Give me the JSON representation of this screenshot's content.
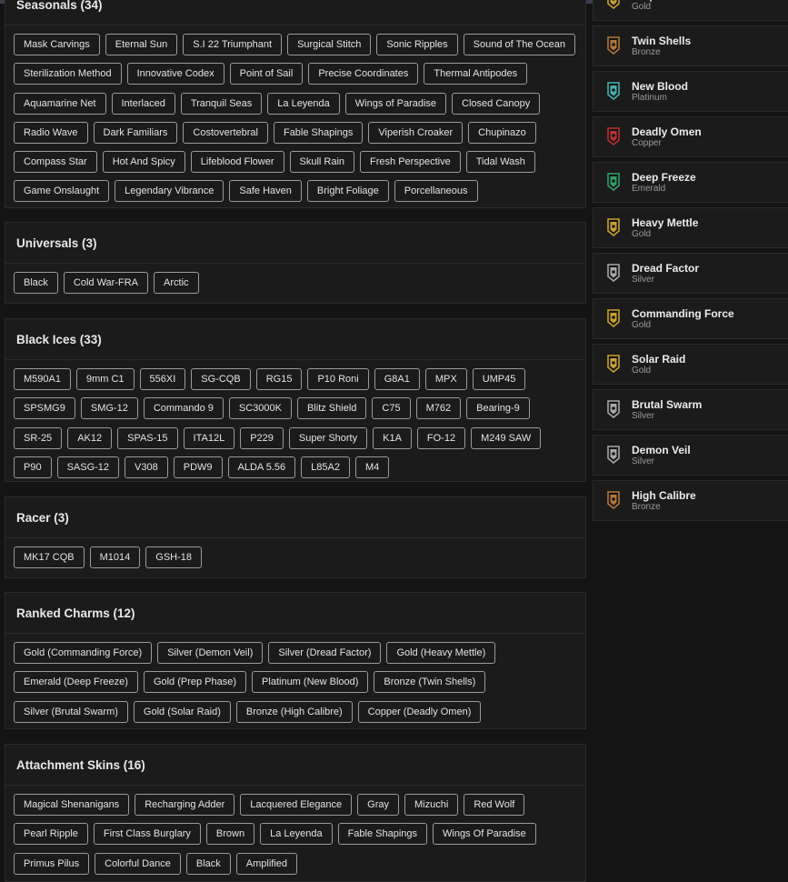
{
  "sections": [
    {
      "title": "Seasonals (34)",
      "items": [
        "Mask Carvings",
        "Eternal Sun",
        "S.I 22 Triumphant",
        "Surgical Stitch",
        "Sonic Ripples",
        "Sound of The Ocean",
        "Sterilization Method",
        "Innovative Codex",
        "Point of Sail",
        "Precise Coordinates",
        "Thermal Antipodes",
        "Aquamarine Net",
        "Interlaced",
        "Tranquil Seas",
        "La Leyenda",
        "Wings of Paradise",
        "Closed Canopy",
        "Radio Wave",
        "Dark Familiars",
        "Costovertebral",
        "Fable Shapings",
        "Viperish Croaker",
        "Chupinazo",
        "Compass Star",
        "Hot And Spicy",
        "Lifeblood Flower",
        "Skull Rain",
        "Fresh Perspective",
        "Tidal Wash",
        "Game Onslaught",
        "Legendary Vibrance",
        "Safe Haven",
        "Bright Foliage",
        "Porcellaneous"
      ]
    },
    {
      "title": "Universals (3)",
      "items": [
        "Black",
        "Cold War-FRA",
        "Arctic"
      ]
    },
    {
      "title": "Black Ices (33)",
      "items": [
        "M590A1",
        "9mm C1",
        "556XI",
        "SG-CQB",
        "RG15",
        "P10 Roni",
        "G8A1",
        "MPX",
        "UMP45",
        "SPSMG9",
        "SMG-12",
        "Commando 9",
        "SC3000K",
        "Blitz Shield",
        "C75",
        "M762",
        "Bearing-9",
        "SR-25",
        "AK12",
        "SPAS-15",
        "ITA12L",
        "P229",
        "Super Shorty",
        "K1A",
        "FO-12",
        "M249 SAW",
        "P90",
        "SASG-12",
        "V308",
        "PDW9",
        "ALDA 5.56",
        "L85A2",
        "M4"
      ]
    },
    {
      "title": "Racer (3)",
      "items": [
        "MK17 CQB",
        "M1014",
        "GSH-18"
      ]
    },
    {
      "title": "Ranked Charms (12)",
      "items": [
        "Gold (Commanding Force)",
        "Silver (Demon Veil)",
        "Silver (Dread Factor)",
        "Gold (Heavy Mettle)",
        "Emerald (Deep Freeze)",
        "Gold (Prep Phase)",
        "Platinum (New Blood)",
        "Bronze (Twin Shells)",
        "Silver (Brutal Swarm)",
        "Gold (Solar Raid)",
        "Bronze (High Calibre)",
        "Copper (Deadly Omen)"
      ]
    },
    {
      "title": "Attachment Skins (16)",
      "items": [
        "Magical Shenanigans",
        "Recharging Adder",
        "Lacquered Elegance",
        "Gray",
        "Mizuchi",
        "Red Wolf",
        "Pearl Ripple",
        "First Class Burglary",
        "Brown",
        "La Leyenda",
        "Fable Shapings",
        "Wings Of Paradise",
        "Primus Pilus",
        "Colorful Dance",
        "Black",
        "Amplified"
      ]
    }
  ],
  "charms": [
    {
      "name": "Prep Phase",
      "tier": "Gold",
      "color": "#c9a227"
    },
    {
      "name": "Twin Shells",
      "tier": "Bronze",
      "color": "#b3773a"
    },
    {
      "name": "New Blood",
      "tier": "Platinum",
      "color": "#3fb3b0"
    },
    {
      "name": "Deadly Omen",
      "tier": "Copper",
      "color": "#b83232"
    },
    {
      "name": "Deep Freeze",
      "tier": "Emerald",
      "color": "#2fa36a"
    },
    {
      "name": "Heavy Mettle",
      "tier": "Gold",
      "color": "#c9a227"
    },
    {
      "name": "Dread Factor",
      "tier": "Silver",
      "color": "#a8a8a8"
    },
    {
      "name": "Commanding Force",
      "tier": "Gold",
      "color": "#c9a227"
    },
    {
      "name": "Solar Raid",
      "tier": "Gold",
      "color": "#c9a227"
    },
    {
      "name": "Brutal Swarm",
      "tier": "Silver",
      "color": "#a8a8a8"
    },
    {
      "name": "Demon Veil",
      "tier": "Silver",
      "color": "#a8a8a8"
    },
    {
      "name": "High Calibre",
      "tier": "Bronze",
      "color": "#b3773a"
    }
  ]
}
